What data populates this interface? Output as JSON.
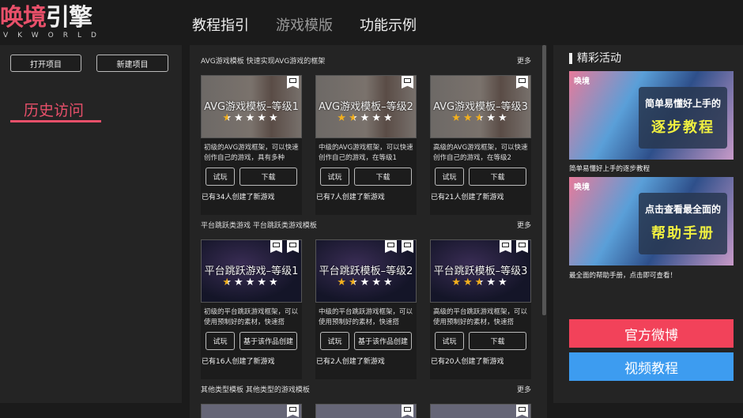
{
  "logo": {
    "main_a": "唤境",
    "main_b": "引擎",
    "sub": "VKWORLD"
  },
  "nav": [
    "教程指引",
    "游戏模版",
    "功能示例"
  ],
  "left": {
    "open": "打开项目",
    "new": "新建项目",
    "history": "历史访问"
  },
  "colors": {
    "accent": "#e8506a",
    "weibo": "#f2425a",
    "video": "#3d9cf0",
    "star": "#f2b01e"
  },
  "sections": [
    {
      "title": "AVG游戏模板   快速实现AVG游戏的框架",
      "more": "更多",
      "thumb": "avg",
      "cards": [
        {
          "title": "AVG游戏模板–等级1",
          "rating": 0.5,
          "icons": [
            "monitor-icon"
          ],
          "desc": "初级的AVG游戏框架，可以快速创作自己的游戏，具有多种",
          "try": "试玩",
          "action": "下载",
          "footer": "已有34人创建了新游戏"
        },
        {
          "title": "AVG游戏模板–等级2",
          "rating": 1.5,
          "icons": [
            "monitor-icon"
          ],
          "desc": "中级的AVG游戏框架，可以快速创作自己的游戏，在等级1",
          "try": "试玩",
          "action": "下载",
          "footer": "已有7人创建了新游戏"
        },
        {
          "title": "AVG游戏模板–等级3",
          "rating": 2.5,
          "icons": [
            "monitor-icon"
          ],
          "desc": "高级的AVG游戏框架，可以快速创作自己的游戏，在等级2",
          "try": "试玩",
          "action": "下载",
          "footer": "已有21人创建了新游戏"
        }
      ]
    },
    {
      "title": "平台跳跃类游戏   平台跳跃类游戏模板",
      "more": "更多",
      "thumb": "plat",
      "cards": [
        {
          "title": "平台跳跃游戏–等级1",
          "rating": 0.5,
          "icons": [
            "monitor-icon",
            "video-icon"
          ],
          "desc": "初级的平台跳跃游戏框架，可以使用预制好的素材，快速搭",
          "try": "试玩",
          "action": "基于该作品创建",
          "footer": "已有16人创建了新游戏"
        },
        {
          "title": "平台跳跃模板–等级2",
          "rating": 1.5,
          "icons": [
            "monitor-icon",
            "video-icon"
          ],
          "desc": "中级的平台跳跃游戏框架，可以使用预制好的素材，快速搭",
          "try": "试玩",
          "action": "基于该作品创建",
          "footer": "已有2人创建了新游戏"
        },
        {
          "title": "平台跳跃模板–等级3",
          "rating": 2.5,
          "icons": [
            "monitor-icon",
            "video-icon"
          ],
          "desc": "高级的平台跳跃游戏框架，可以使用预制好的素材，快速搭",
          "try": "试玩",
          "action": "下载",
          "footer": "已有20人创建了新游戏"
        }
      ]
    },
    {
      "title": "其他类型模板   其他类型的游戏模板",
      "more": "更多",
      "thumb": "other",
      "cards": [
        {
          "icons": [
            "monitor-icon"
          ]
        },
        {
          "icons": [
            "monitor-icon"
          ]
        },
        {
          "icons": [
            "monitor-icon"
          ]
        }
      ]
    }
  ],
  "right": {
    "title": "精彩活动",
    "banners": [
      {
        "logo": "唤境",
        "line1": "简单易懂好上手的",
        "line2": "逐步教程",
        "caption": "简单易懂好上手的逐步教程"
      },
      {
        "logo": "唤境",
        "line1": "点击查看最全面的",
        "line2": "帮助手册",
        "caption": "最全面的帮助手册，点击即可查看！"
      }
    ],
    "weibo": "官方微博",
    "video": "视频教程"
  }
}
